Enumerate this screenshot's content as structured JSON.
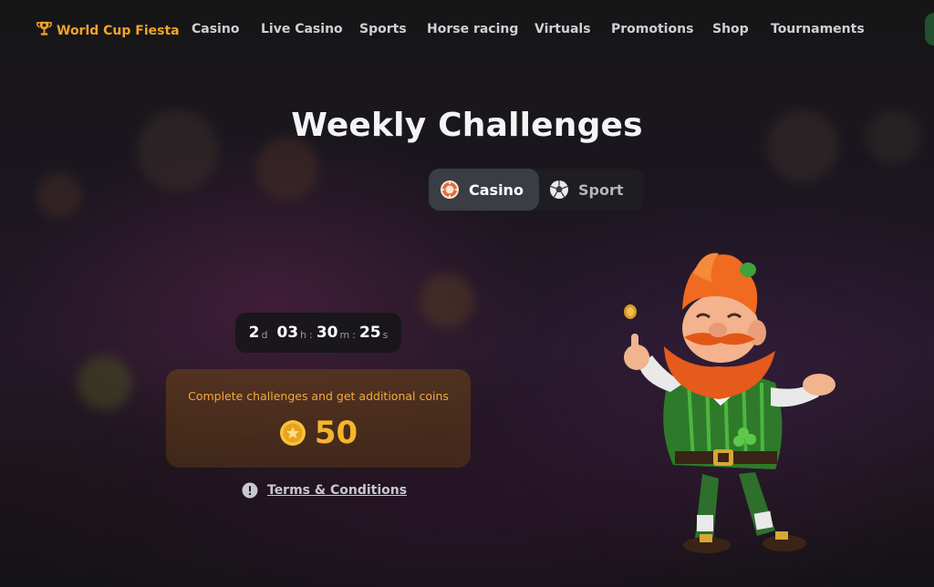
{
  "nav": {
    "brand": {
      "label": "World Cup Fiesta",
      "icon": "trophy-icon",
      "color": "#f2a32a"
    },
    "items": [
      {
        "label": "Casino"
      },
      {
        "label": "Live Casino"
      },
      {
        "label": "Sports"
      },
      {
        "label": "Horse racing"
      },
      {
        "label": "Virtuals"
      },
      {
        "label": "Promotions"
      },
      {
        "label": "Shop"
      },
      {
        "label": "Tournaments"
      }
    ]
  },
  "page": {
    "title": "Weekly Challenges",
    "tabs": [
      {
        "label": "Casino",
        "icon": "casino-chip-icon",
        "selected": true
      },
      {
        "label": "Sport",
        "icon": "soccer-ball-icon",
        "selected": false
      }
    ]
  },
  "timer": {
    "days": "2",
    "days_unit": "d",
    "hours": "03",
    "hours_unit": "h",
    "minutes": "30",
    "minutes_unit": "m",
    "seconds": "25",
    "seconds_unit": "s",
    "separator": ":"
  },
  "reward": {
    "text": "Complete challenges and get additional coins",
    "value": "50",
    "icon": "star-coin-icon",
    "accent": "#f4b62a"
  },
  "terms": {
    "label": "Terms & Conditions",
    "icon": "info-icon"
  },
  "mascot": {
    "icon": "leprechaun-mascot-illustration"
  }
}
